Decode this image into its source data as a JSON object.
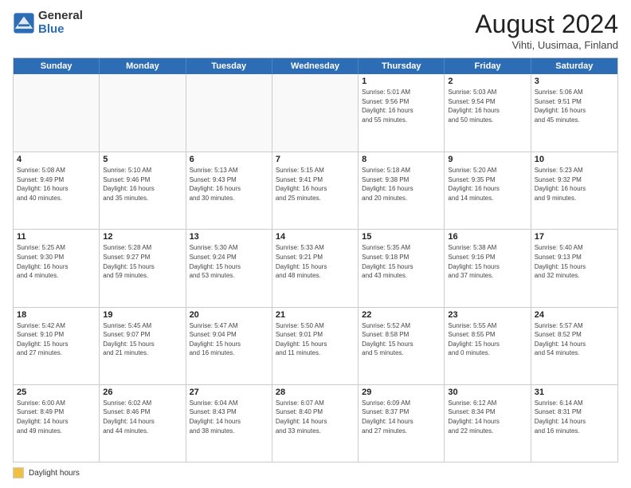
{
  "logo": {
    "general": "General",
    "blue": "Blue"
  },
  "header": {
    "month": "August 2024",
    "location": "Vihti, Uusimaa, Finland"
  },
  "days_of_week": [
    "Sunday",
    "Monday",
    "Tuesday",
    "Wednesday",
    "Thursday",
    "Friday",
    "Saturday"
  ],
  "legend": {
    "label": "Daylight hours"
  },
  "weeks": [
    [
      {
        "day": "",
        "info": ""
      },
      {
        "day": "",
        "info": ""
      },
      {
        "day": "",
        "info": ""
      },
      {
        "day": "",
        "info": ""
      },
      {
        "day": "1",
        "info": "Sunrise: 5:01 AM\nSunset: 9:56 PM\nDaylight: 16 hours\nand 55 minutes."
      },
      {
        "day": "2",
        "info": "Sunrise: 5:03 AM\nSunset: 9:54 PM\nDaylight: 16 hours\nand 50 minutes."
      },
      {
        "day": "3",
        "info": "Sunrise: 5:06 AM\nSunset: 9:51 PM\nDaylight: 16 hours\nand 45 minutes."
      }
    ],
    [
      {
        "day": "4",
        "info": "Sunrise: 5:08 AM\nSunset: 9:49 PM\nDaylight: 16 hours\nand 40 minutes."
      },
      {
        "day": "5",
        "info": "Sunrise: 5:10 AM\nSunset: 9:46 PM\nDaylight: 16 hours\nand 35 minutes."
      },
      {
        "day": "6",
        "info": "Sunrise: 5:13 AM\nSunset: 9:43 PM\nDaylight: 16 hours\nand 30 minutes."
      },
      {
        "day": "7",
        "info": "Sunrise: 5:15 AM\nSunset: 9:41 PM\nDaylight: 16 hours\nand 25 minutes."
      },
      {
        "day": "8",
        "info": "Sunrise: 5:18 AM\nSunset: 9:38 PM\nDaylight: 16 hours\nand 20 minutes."
      },
      {
        "day": "9",
        "info": "Sunrise: 5:20 AM\nSunset: 9:35 PM\nDaylight: 16 hours\nand 14 minutes."
      },
      {
        "day": "10",
        "info": "Sunrise: 5:23 AM\nSunset: 9:32 PM\nDaylight: 16 hours\nand 9 minutes."
      }
    ],
    [
      {
        "day": "11",
        "info": "Sunrise: 5:25 AM\nSunset: 9:30 PM\nDaylight: 16 hours\nand 4 minutes."
      },
      {
        "day": "12",
        "info": "Sunrise: 5:28 AM\nSunset: 9:27 PM\nDaylight: 15 hours\nand 59 minutes."
      },
      {
        "day": "13",
        "info": "Sunrise: 5:30 AM\nSunset: 9:24 PM\nDaylight: 15 hours\nand 53 minutes."
      },
      {
        "day": "14",
        "info": "Sunrise: 5:33 AM\nSunset: 9:21 PM\nDaylight: 15 hours\nand 48 minutes."
      },
      {
        "day": "15",
        "info": "Sunrise: 5:35 AM\nSunset: 9:18 PM\nDaylight: 15 hours\nand 43 minutes."
      },
      {
        "day": "16",
        "info": "Sunrise: 5:38 AM\nSunset: 9:16 PM\nDaylight: 15 hours\nand 37 minutes."
      },
      {
        "day": "17",
        "info": "Sunrise: 5:40 AM\nSunset: 9:13 PM\nDaylight: 15 hours\nand 32 minutes."
      }
    ],
    [
      {
        "day": "18",
        "info": "Sunrise: 5:42 AM\nSunset: 9:10 PM\nDaylight: 15 hours\nand 27 minutes."
      },
      {
        "day": "19",
        "info": "Sunrise: 5:45 AM\nSunset: 9:07 PM\nDaylight: 15 hours\nand 21 minutes."
      },
      {
        "day": "20",
        "info": "Sunrise: 5:47 AM\nSunset: 9:04 PM\nDaylight: 15 hours\nand 16 minutes."
      },
      {
        "day": "21",
        "info": "Sunrise: 5:50 AM\nSunset: 9:01 PM\nDaylight: 15 hours\nand 11 minutes."
      },
      {
        "day": "22",
        "info": "Sunrise: 5:52 AM\nSunset: 8:58 PM\nDaylight: 15 hours\nand 5 minutes."
      },
      {
        "day": "23",
        "info": "Sunrise: 5:55 AM\nSunset: 8:55 PM\nDaylight: 15 hours\nand 0 minutes."
      },
      {
        "day": "24",
        "info": "Sunrise: 5:57 AM\nSunset: 8:52 PM\nDaylight: 14 hours\nand 54 minutes."
      }
    ],
    [
      {
        "day": "25",
        "info": "Sunrise: 6:00 AM\nSunset: 8:49 PM\nDaylight: 14 hours\nand 49 minutes."
      },
      {
        "day": "26",
        "info": "Sunrise: 6:02 AM\nSunset: 8:46 PM\nDaylight: 14 hours\nand 44 minutes."
      },
      {
        "day": "27",
        "info": "Sunrise: 6:04 AM\nSunset: 8:43 PM\nDaylight: 14 hours\nand 38 minutes."
      },
      {
        "day": "28",
        "info": "Sunrise: 6:07 AM\nSunset: 8:40 PM\nDaylight: 14 hours\nand 33 minutes."
      },
      {
        "day": "29",
        "info": "Sunrise: 6:09 AM\nSunset: 8:37 PM\nDaylight: 14 hours\nand 27 minutes."
      },
      {
        "day": "30",
        "info": "Sunrise: 6:12 AM\nSunset: 8:34 PM\nDaylight: 14 hours\nand 22 minutes."
      },
      {
        "day": "31",
        "info": "Sunrise: 6:14 AM\nSunset: 8:31 PM\nDaylight: 14 hours\nand 16 minutes."
      }
    ]
  ]
}
